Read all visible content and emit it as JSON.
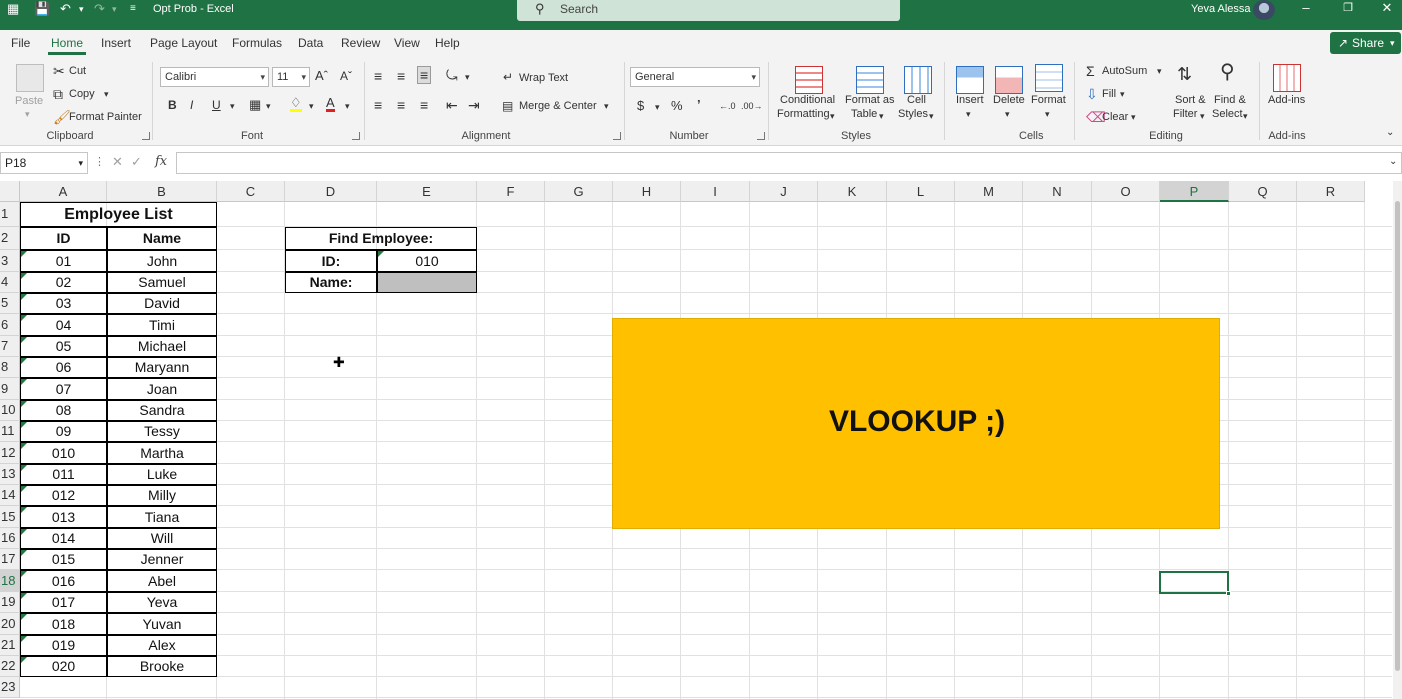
{
  "titlebar": {
    "doc_title": "Opt Prob  -  Excel",
    "search_placeholder": "Search",
    "user_name": "Yeva Alessa",
    "share_label": "Share"
  },
  "menu": [
    "File",
    "Home",
    "Insert",
    "Page Layout",
    "Formulas",
    "Data",
    "Review",
    "View",
    "Help"
  ],
  "ribbon": {
    "clipboard": {
      "paste": "Paste",
      "cut": "Cut",
      "copy": "Copy",
      "format_painter": "Format Painter",
      "label": "Clipboard"
    },
    "font": {
      "name": "Calibri",
      "size": "11",
      "label": "Font"
    },
    "alignment": {
      "wrap": "Wrap Text",
      "merge": "Merge & Center",
      "label": "Alignment"
    },
    "number": {
      "format": "General",
      "label": "Number"
    },
    "styles": {
      "cond1": "Conditional",
      "cond2": "Formatting",
      "fat1": "Format as",
      "fat2": "Table",
      "cs1": "Cell",
      "cs2": "Styles",
      "label": "Styles"
    },
    "cells": {
      "insert": "Insert",
      "delete": "Delete",
      "format": "Format",
      "label": "Cells"
    },
    "editing": {
      "autosum": "AutoSum",
      "fill": "Fill",
      "clear": "Clear",
      "sort1": "Sort &",
      "sort2": "Filter",
      "find1": "Find &",
      "find2": "Select",
      "label": "Editing"
    },
    "addins": {
      "btn": "Add-ins",
      "label": "Add-ins"
    }
  },
  "formula_bar": {
    "name_box": "P18",
    "content": ""
  },
  "columns": [
    "A",
    "B",
    "C",
    "D",
    "E",
    "F",
    "G",
    "H",
    "I",
    "J",
    "K",
    "L",
    "M",
    "N",
    "O",
    "P",
    "Q",
    "R"
  ],
  "rows": [
    "1",
    "2",
    "3",
    "4",
    "5",
    "6",
    "7",
    "8",
    "9",
    "10",
    "11",
    "12",
    "13",
    "14",
    "15",
    "16",
    "17",
    "18",
    "19",
    "20",
    "21",
    "22",
    "23"
  ],
  "selected_cell": "P18",
  "table": {
    "title": "Employee List",
    "headers": [
      "ID",
      "Name"
    ],
    "rows": [
      [
        "01",
        "John"
      ],
      [
        "02",
        "Samuel"
      ],
      [
        "03",
        "David"
      ],
      [
        "04",
        "Timi"
      ],
      [
        "05",
        "Michael"
      ],
      [
        "06",
        "Maryann"
      ],
      [
        "07",
        "Joan"
      ],
      [
        "08",
        "Sandra"
      ],
      [
        "09",
        "Tessy"
      ],
      [
        "010",
        "Martha"
      ],
      [
        "011",
        "Luke"
      ],
      [
        "012",
        "Milly"
      ],
      [
        "013",
        "Tiana"
      ],
      [
        "014",
        "Will"
      ],
      [
        "015",
        "Jenner"
      ],
      [
        "016",
        "Abel"
      ],
      [
        "017",
        "Yeva"
      ],
      [
        "018",
        "Yuvan"
      ],
      [
        "019",
        "Alex"
      ],
      [
        "020",
        "Brooke"
      ]
    ]
  },
  "finder": {
    "title": "Find Employee:",
    "id_label": "ID:",
    "id_value": "010",
    "name_label": "Name:",
    "name_value": "",
    "name_fill": "#bfbfbf"
  },
  "banner": {
    "text": "VLOOKUP ;)",
    "color": "#ffc000"
  },
  "colors": {
    "accent": "#1f7244"
  }
}
